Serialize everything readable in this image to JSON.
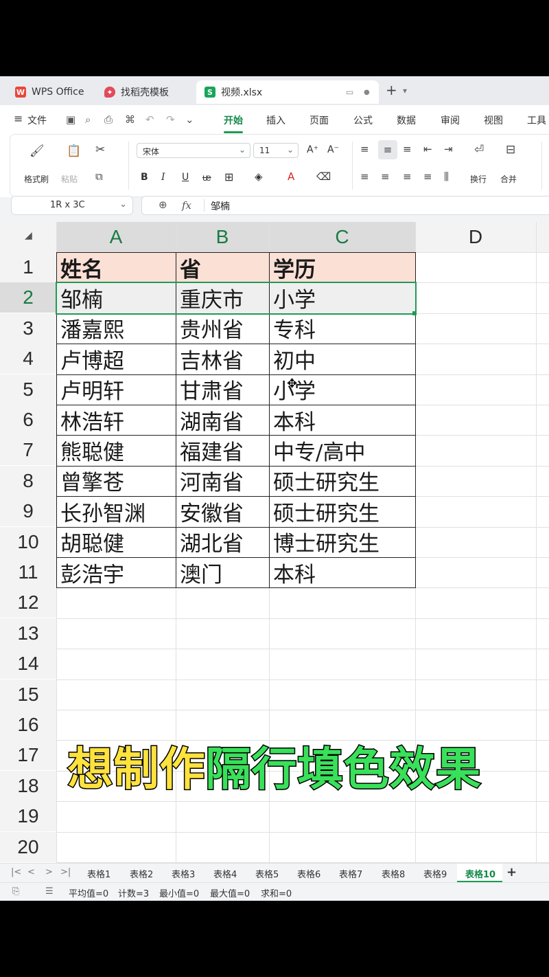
{
  "titlebar": {
    "tabs": [
      {
        "label": "WPS Office",
        "logo": "W"
      },
      {
        "label": "找稻壳模板",
        "logo": "✦"
      },
      {
        "label": "视频.xlsx",
        "logo": "S"
      }
    ],
    "new_tab": "+"
  },
  "menubar": {
    "file": "文件",
    "items": [
      "开始",
      "插入",
      "页面",
      "公式",
      "数据",
      "审阅",
      "视图",
      "工具"
    ],
    "active": "开始"
  },
  "ribbon": {
    "format_painter": "格式刷",
    "paste": "粘贴",
    "font_name": "宋体",
    "font_size": "11",
    "wrap": "换行",
    "merge": "合并"
  },
  "formula_bar": {
    "name_box": "1R x 3C",
    "fx": "fx",
    "value": "邹楠"
  },
  "grid": {
    "columns": [
      "A",
      "B",
      "C",
      "D"
    ],
    "rows": [
      "1",
      "2",
      "3",
      "4",
      "5",
      "6",
      "7",
      "8",
      "9",
      "10",
      "11",
      "12",
      "13",
      "14",
      "15",
      "16",
      "17",
      "18",
      "19",
      "20"
    ],
    "table": [
      [
        "姓名",
        "省",
        "学历"
      ],
      [
        "邹楠",
        "重庆市",
        "小学"
      ],
      [
        "潘嘉熙",
        "贵州省",
        "专科"
      ],
      [
        "卢博超",
        "吉林省",
        "初中"
      ],
      [
        "卢明轩",
        "甘肃省",
        "小学"
      ],
      [
        "林浩轩",
        "湖南省",
        "本科"
      ],
      [
        "熊聪健",
        "福建省",
        "中专/高中"
      ],
      [
        "曾擎苍",
        "河南省",
        "硕士研究生"
      ],
      [
        "长孙智渊",
        "安徽省",
        "硕士研究生"
      ],
      [
        "胡聪健",
        "湖北省",
        "博士研究生"
      ],
      [
        "彭浩宇",
        "澳门",
        "本科"
      ]
    ],
    "header_fill": "#fbe0d6",
    "selection_color": "#1e9b57"
  },
  "caption": {
    "part1": "想制作",
    "part2": "隔行填色效果"
  },
  "sheets": {
    "tabs": [
      "表格1",
      "表格2",
      "表格3",
      "表格4",
      "表格5",
      "表格6",
      "表格7",
      "表格8",
      "表格9",
      "表格10"
    ],
    "active": "表格10",
    "add": "+"
  },
  "status": {
    "average": "平均值=0",
    "count": "计数=3",
    "min": "最小值=0",
    "max": "最大值=0",
    "sum": "求和=0"
  }
}
